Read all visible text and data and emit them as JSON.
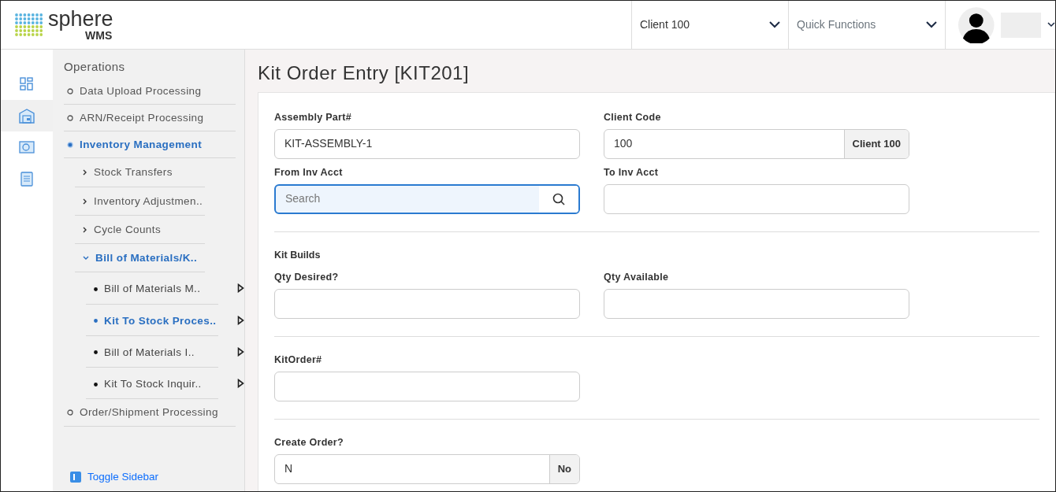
{
  "header": {
    "logo": {
      "name": "sphere",
      "sub": "WMS"
    },
    "client_select": {
      "value": "Client 100"
    },
    "quick_functions": {
      "placeholder": "Quick Functions"
    }
  },
  "rail": [
    {
      "kind": "dashboard",
      "selected": false
    },
    {
      "kind": "warehouse",
      "selected": true
    },
    {
      "kind": "map",
      "selected": false
    },
    {
      "kind": "report",
      "selected": false
    }
  ],
  "sidebar": {
    "heading": "Operations",
    "items": [
      {
        "label": "Data Upload Processing",
        "selected": false
      },
      {
        "label": "ARN/Receipt Processing",
        "selected": false
      },
      {
        "label": "Inventory Management",
        "selected": true,
        "children": [
          {
            "label": "Stock Transfers",
            "selected": false,
            "expanded": false
          },
          {
            "label": "Inventory Adjustmen..",
            "selected": false,
            "expanded": false
          },
          {
            "label": "Cycle Counts",
            "selected": false,
            "expanded": false
          },
          {
            "label": "Bill of Materials/K..",
            "selected": true,
            "expanded": true,
            "children": [
              {
                "label": "Bill of Materials M..",
                "selected": false
              },
              {
                "label": "Kit To Stock Proces..",
                "selected": true
              },
              {
                "label": "Bill of Materials I..",
                "selected": false
              },
              {
                "label": "Kit To Stock Inquir..",
                "selected": false
              }
            ]
          }
        ]
      },
      {
        "label": "Order/Shipment Processing",
        "selected": false
      }
    ],
    "toggle": "Toggle Sidebar"
  },
  "page_title": "Kit Order Entry [KIT201]",
  "sections": [
    {
      "rows": [
        [
          {
            "label": "Assembly Part#",
            "kind": "text",
            "value": "KIT-ASSEMBLY-1",
            "focused": false
          },
          {
            "label": "Client Code",
            "kind": "addon",
            "value": "100",
            "addon": "Client 100",
            "focused": false
          }
        ],
        [
          {
            "label": "From Inv Acct",
            "kind": "search",
            "placeholder": "Search",
            "focused": true
          },
          {
            "label": "To Inv Acct",
            "kind": "text",
            "focused": false
          }
        ]
      ]
    },
    {
      "heading": "Kit Builds",
      "rows": [
        [
          {
            "label": "Qty Desired?",
            "kind": "text",
            "focused": false
          },
          {
            "label": "Qty Available",
            "kind": "text",
            "focused": false
          }
        ]
      ]
    },
    {
      "rows": [
        [
          {
            "label": "KitOrder#",
            "kind": "text",
            "focused": false
          }
        ]
      ]
    },
    {
      "rows": [
        [
          {
            "label": "Create Order?",
            "kind": "addon",
            "value": "N",
            "addon": "No",
            "focused": false
          }
        ]
      ]
    }
  ]
}
